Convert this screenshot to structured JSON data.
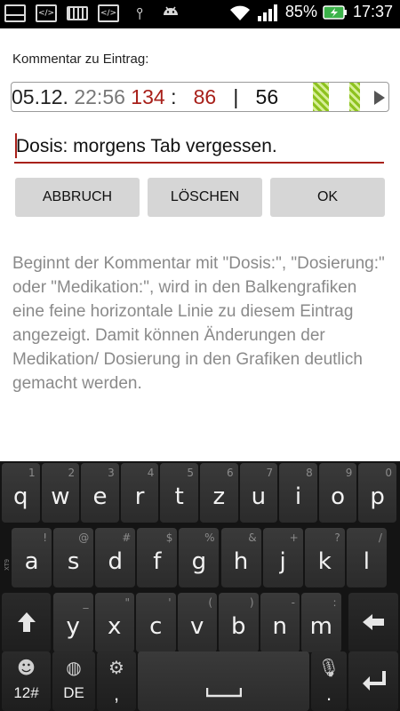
{
  "status_bar": {
    "battery_percent": "85%",
    "time": "17:37",
    "icons": [
      "gallery-icon",
      "code-icon",
      "keyboard-icon",
      "code-icon",
      "usb-icon",
      "android-icon"
    ]
  },
  "dialog": {
    "title": "Kommentar zu Eintrag:",
    "entry": {
      "date": "05.12.",
      "time": "22:56",
      "systolic": "134",
      "sep1": ":",
      "diastolic": "86",
      "sep2": "|",
      "pulse": "56"
    },
    "comment_value": "Dosis: morgens Tab vergessen.",
    "buttons": {
      "cancel": "ABBRUCH",
      "delete": "LÖSCHEN",
      "ok": "OK"
    },
    "hint": "Beginnt der Kommentar mit \"Dosis:\", \"Dosierung:\" oder \"Medikation:\", wird in den Balkengrafiken eine feine horizontale Linie zu diesem Eintrag angezeigt. Damit können Änderungen der Medikation/ Dosierung in den Grafiken deutlich gemacht werden."
  },
  "keyboard": {
    "row1": [
      {
        "k": "q",
        "h": "1"
      },
      {
        "k": "w",
        "h": "2"
      },
      {
        "k": "e",
        "h": "3"
      },
      {
        "k": "r",
        "h": "4"
      },
      {
        "k": "t",
        "h": "5"
      },
      {
        "k": "z",
        "h": "6"
      },
      {
        "k": "u",
        "h": "7"
      },
      {
        "k": "i",
        "h": "8"
      },
      {
        "k": "o",
        "h": "9"
      },
      {
        "k": "p",
        "h": "0"
      }
    ],
    "row2": [
      {
        "k": "a",
        "h": "!"
      },
      {
        "k": "s",
        "h": "@"
      },
      {
        "k": "d",
        "h": "#"
      },
      {
        "k": "f",
        "h": "$"
      },
      {
        "k": "g",
        "h": "%"
      },
      {
        "k": "h",
        "h": "&"
      },
      {
        "k": "j",
        "h": "+"
      },
      {
        "k": "k",
        "h": "?"
      },
      {
        "k": "l",
        "h": "/"
      }
    ],
    "row3": [
      {
        "k": "y",
        "h": "_"
      },
      {
        "k": "x",
        "h": "\""
      },
      {
        "k": "c",
        "h": "'"
      },
      {
        "k": "v",
        "h": "("
      },
      {
        "k": "b",
        "h": ")"
      },
      {
        "k": "n",
        "h": "-"
      },
      {
        "k": "m",
        "h": ":"
      }
    ],
    "symbols_label": "12#",
    "language_label": "DE",
    "comma": ",",
    "period": ".",
    "xt9": "XT9"
  }
}
